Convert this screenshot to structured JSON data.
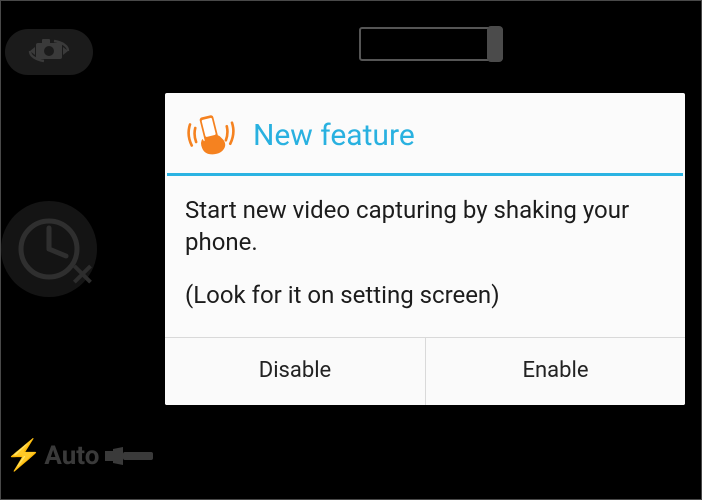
{
  "dialog": {
    "title": "New feature",
    "body_line1": "Start new video capturing by shaking your phone.",
    "body_line2": "(Look for it on setting screen)",
    "disable_label": "Disable",
    "enable_label": "Enable"
  },
  "background": {
    "flash_mode_label": "Auto"
  },
  "icons": {
    "switch_camera": "switch-camera-icon",
    "timer": "timer-icon",
    "flash_bolt": "bolt-icon",
    "torch": "torch-icon",
    "shake_phone": "shake-phone-icon"
  }
}
